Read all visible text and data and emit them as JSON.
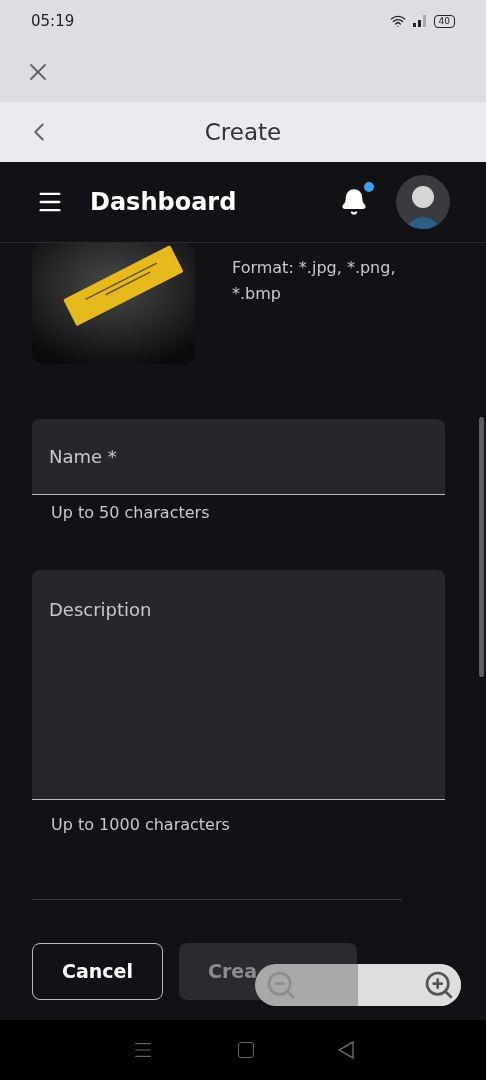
{
  "status_bar": {
    "time": "05:19",
    "battery": "40"
  },
  "browser": {
    "title": "Create"
  },
  "header": {
    "title": "Dashboard",
    "notification_dot": true
  },
  "upload": {
    "format_text": "Format: *.jpg, *.png, *.bmp"
  },
  "fields": [
    {
      "kind": "input",
      "placeholder": "Name *",
      "helper": "Up to 50 characters"
    },
    {
      "kind": "textarea",
      "placeholder": "Description",
      "helper": "Up to 1000 characters"
    }
  ],
  "buttons": [
    {
      "label": "Cancel",
      "kind": "outline",
      "disabled": false
    },
    {
      "label": "Crea",
      "kind": "primary",
      "disabled": true
    }
  ]
}
